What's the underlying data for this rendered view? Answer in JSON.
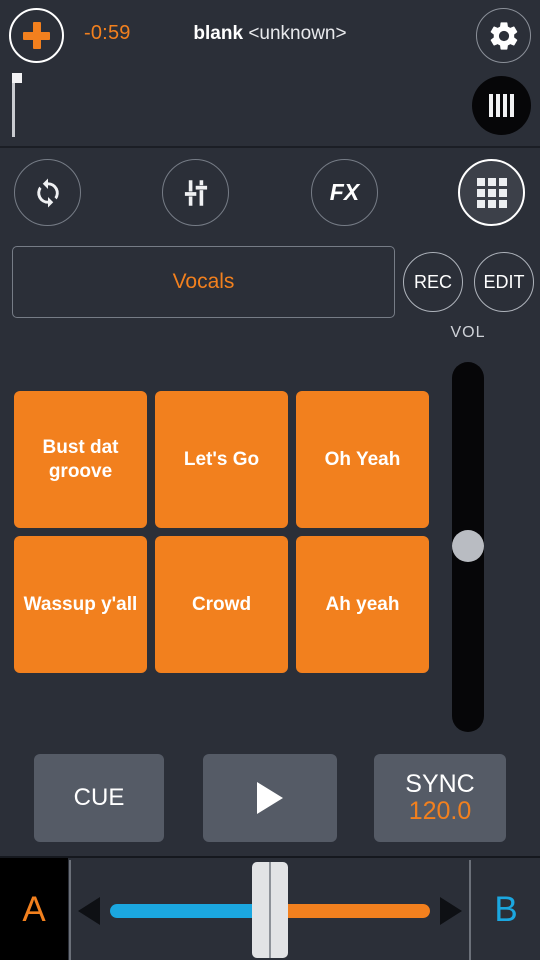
{
  "header": {
    "add_button_icon": "plus-icon",
    "time_remaining": "-0:59",
    "track_name": "blank",
    "track_artist": "<unknown>",
    "settings_icon": "gear-icon",
    "eq_icon": "equalizer-bars-icon",
    "playhead_position": "0%"
  },
  "toolbar": {
    "items": [
      {
        "name": "loop",
        "icon": "loop-repeat-icon",
        "active": false,
        "label": ""
      },
      {
        "name": "mixer",
        "icon": "faders-icon",
        "active": false,
        "label": ""
      },
      {
        "name": "fx",
        "icon": "fx-text-icon",
        "active": false,
        "label": "FX"
      },
      {
        "name": "pads",
        "icon": "grid-3x3-icon",
        "active": true,
        "label": ""
      }
    ]
  },
  "channel": {
    "bank_label": "Vocals",
    "rec_label": "REC",
    "edit_label": "EDIT"
  },
  "volume": {
    "label": "VOL",
    "value_percent": 50
  },
  "pads": [
    {
      "label": "Bust dat groove"
    },
    {
      "label": "Let's Go"
    },
    {
      "label": "Oh Yeah"
    },
    {
      "label": "Wassup y'all"
    },
    {
      "label": "Crowd"
    },
    {
      "label": "Ah yeah"
    }
  ],
  "transport": {
    "cue_label": "CUE",
    "play_icon": "play-triangle-icon",
    "sync_label": "SYNC",
    "bpm": "120.0"
  },
  "crossfader": {
    "deck_a_label": "A",
    "deck_b_label": "B",
    "left_arrow_icon": "arrow-left-icon",
    "right_arrow_icon": "arrow-right-icon",
    "position_percent": 50
  },
  "colors": {
    "background": "#2b2f38",
    "accent_orange": "#f2801e",
    "accent_blue": "#1ba7e0",
    "button_gray": "#555b66",
    "black": "#000000",
    "text_white": "#ffffff"
  }
}
